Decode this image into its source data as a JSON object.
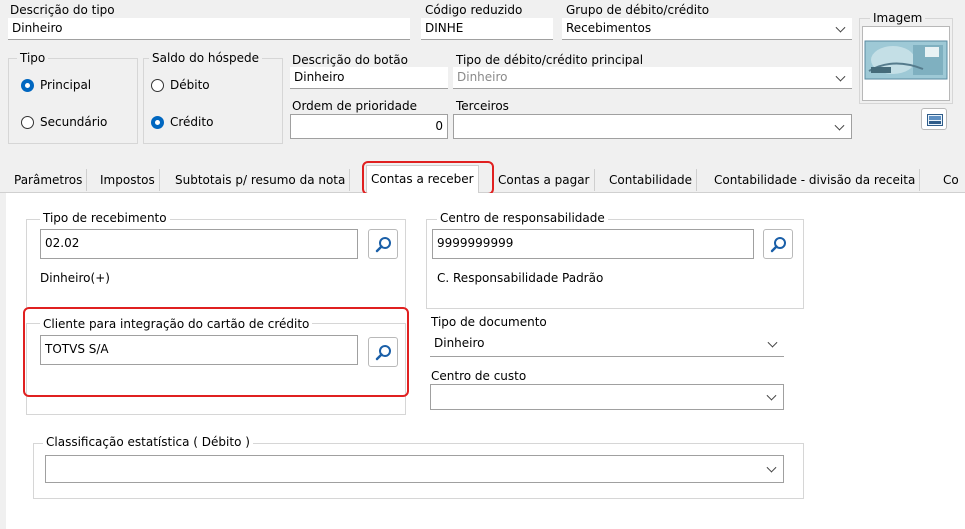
{
  "header": {
    "descricao_label": "Descrição do tipo",
    "descricao_value": "Dinheiro",
    "codigo_label": "Código reduzido",
    "codigo_value": "DINHE",
    "grupo_label": "Grupo de débito/crédito",
    "grupo_value": "Recebimentos",
    "imagem_label": "Imagem",
    "tipo_label": "Tipo",
    "tipo_options": [
      "Principal",
      "Secundário"
    ],
    "tipo_selected": "Principal",
    "saldo_label": "Saldo do hóspede",
    "saldo_options": [
      "Débito",
      "Crédito"
    ],
    "saldo_selected": "Crédito",
    "botao_label": "Descrição do botão",
    "botao_value": "Dinheiro",
    "tipo_principal_label": "Tipo de débito/crédito principal",
    "tipo_principal_value": "Dinheiro",
    "ordem_label": "Ordem de prioridade",
    "ordem_value": "0",
    "terceiros_label": "Terceiros",
    "terceiros_value": ""
  },
  "tabs": [
    {
      "label": "Parâmetros"
    },
    {
      "label": "Impostos"
    },
    {
      "label": "Subtotais p/ resumo da nota"
    },
    {
      "label": "Contas a receber"
    },
    {
      "label": "Contas a pagar"
    },
    {
      "label": "Contabilidade"
    },
    {
      "label": "Contabilidade - divisão da receita"
    },
    {
      "label": "Co"
    }
  ],
  "active_tab": "Contas a receber",
  "contas_receber": {
    "tipo_recebimento_label": "Tipo de recebimento",
    "tipo_recebimento_value": "02.02",
    "tipo_recebimento_desc": "Dinheiro(+)",
    "centro_resp_label": "Centro de responsabilidade",
    "centro_resp_value": "9999999999",
    "centro_resp_desc": "C. Responsabilidade Padrão",
    "cliente_label": "Cliente para integração do cartão de crédito",
    "cliente_value": "TOTVS S/A",
    "tipo_documento_label": "Tipo de documento",
    "tipo_documento_value": "Dinheiro",
    "centro_custo_label": "Centro de custo",
    "centro_custo_value": "",
    "classificacao_label": "Classificação estatística ( Débito )",
    "classificacao_value": ""
  },
  "colors": {
    "highlight": "#e02020",
    "radio_selected": "#0067c0"
  },
  "icons": [
    "search-icon",
    "chevron-down-icon",
    "image-picker-icon",
    "banknote-image"
  ]
}
